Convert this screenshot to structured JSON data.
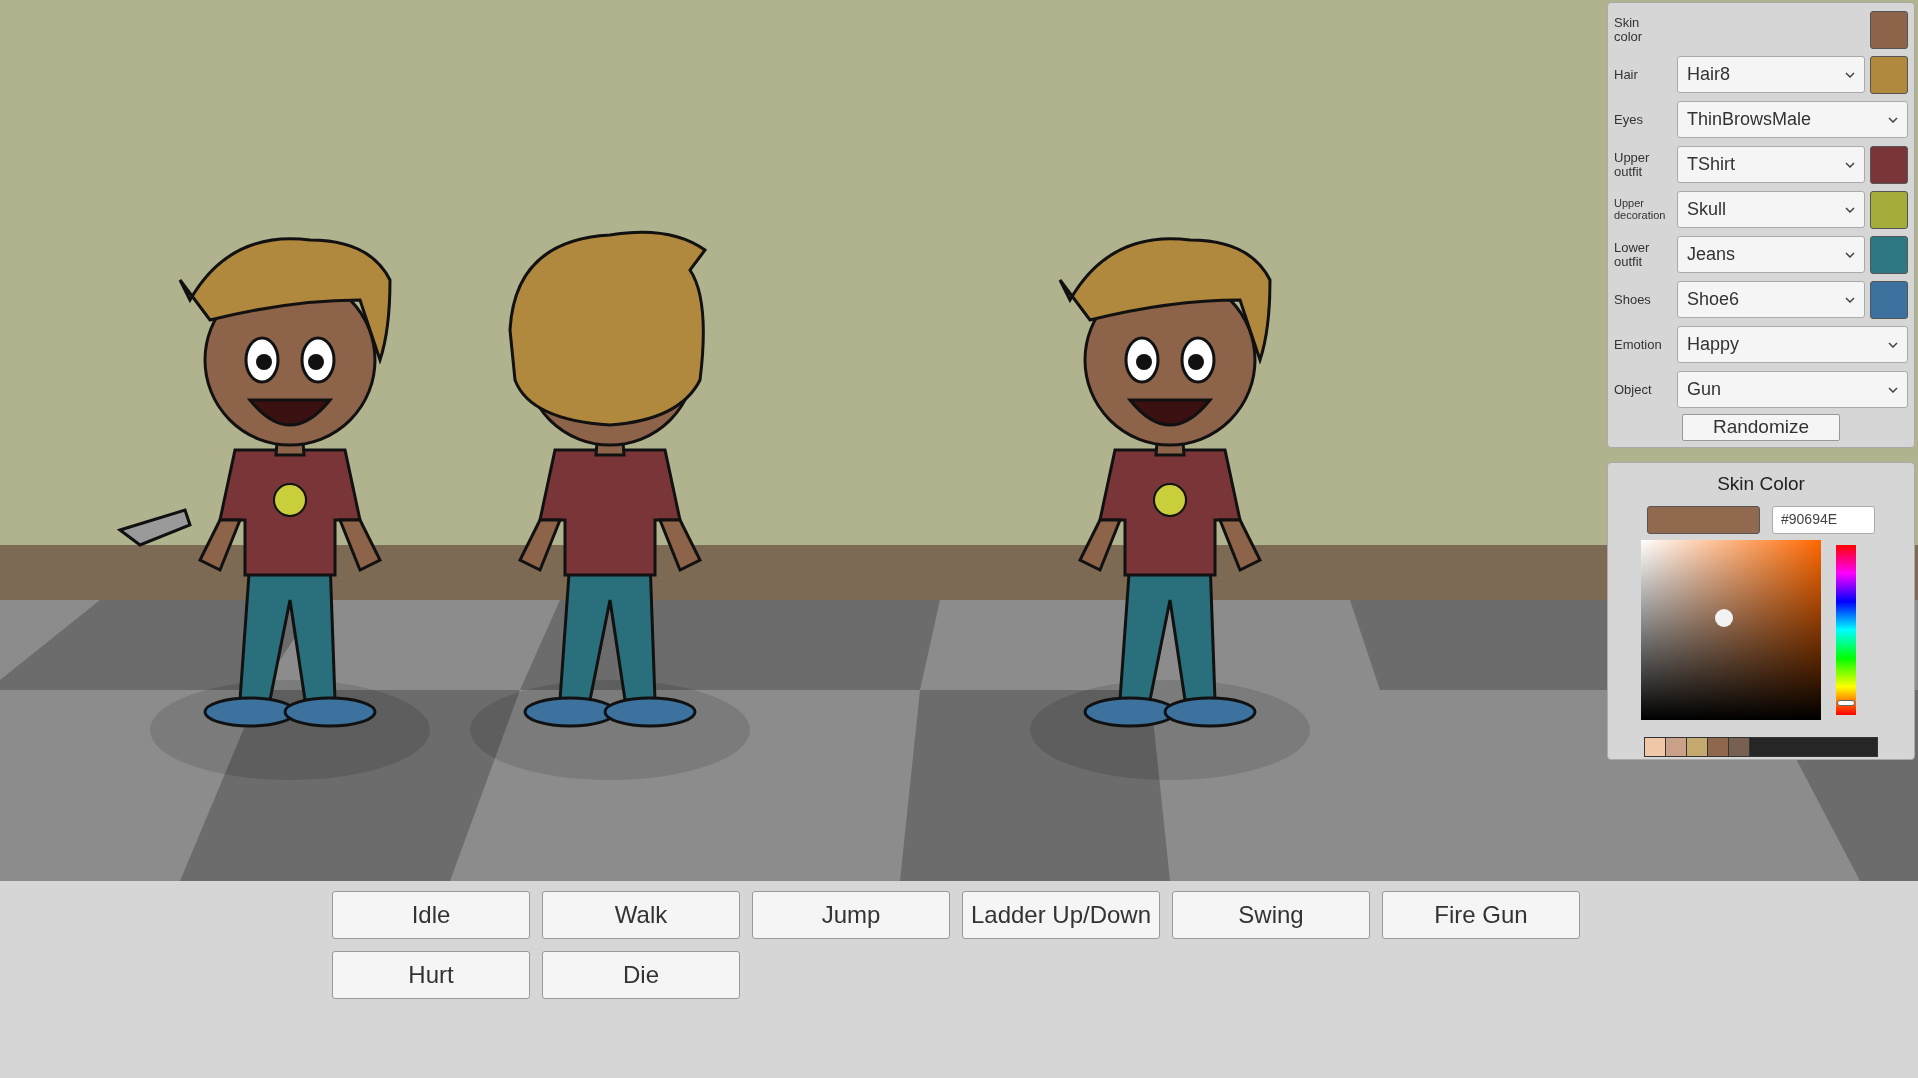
{
  "customizer": {
    "rows": [
      {
        "kind": "swatch",
        "label": "Skin color",
        "color": "#8d6449"
      },
      {
        "kind": "dropdown_swatch",
        "label": "Hair",
        "value": "Hair8",
        "color": "#b0883e"
      },
      {
        "kind": "dropdown",
        "label": "Eyes",
        "value": "ThinBrowsMale"
      },
      {
        "kind": "dropdown_swatch",
        "label": "Upper outfit",
        "value": "TShirt",
        "color": "#7a3539"
      },
      {
        "kind": "dropdown_swatch",
        "label": "Upper decoration",
        "value": "Skull",
        "color": "#a4ad39"
      },
      {
        "kind": "dropdown_swatch",
        "label": "Lower outfit",
        "value": "Jeans",
        "color": "#2e7884"
      },
      {
        "kind": "dropdown_swatch",
        "label": "Shoes",
        "value": "Shoe6",
        "color": "#3d729f"
      },
      {
        "kind": "dropdown",
        "label": "Emotion",
        "value": "Happy"
      },
      {
        "kind": "dropdown",
        "label": "Object",
        "value": "Gun"
      }
    ],
    "randomize": "Randomize"
  },
  "color_picker": {
    "title": "Skin Color",
    "hex": "#90694E",
    "hue_slider": {
      "level": 0.07
    },
    "palette": [
      {
        "color": "#f0c8a8"
      },
      {
        "color": "#c9a088"
      },
      {
        "color": "#c4a96e"
      },
      {
        "color": "#8f674c"
      },
      {
        "color": "#77604f"
      }
    ]
  },
  "animations": [
    [
      "Idle",
      "Walk",
      "Jump",
      "Ladder Up/Down",
      "Swing",
      "Fire Gun"
    ],
    [
      "Hurt",
      "Die"
    ]
  ]
}
